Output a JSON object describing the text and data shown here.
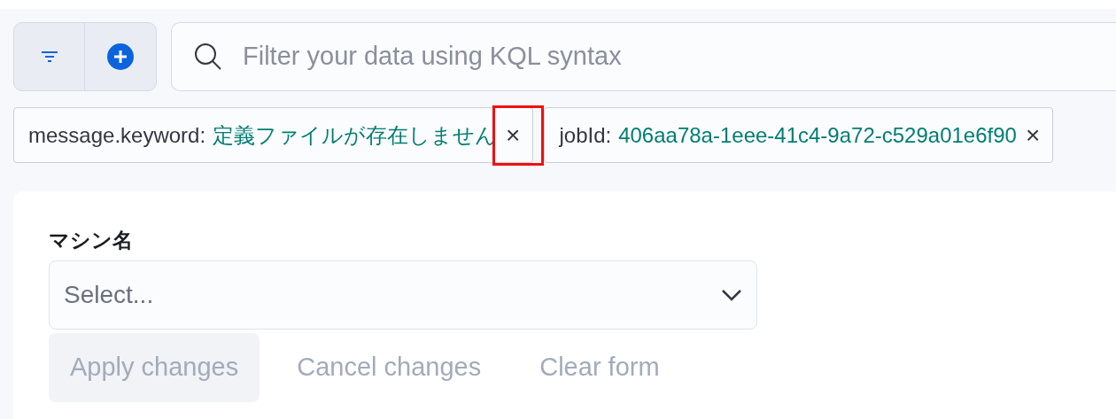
{
  "query_bar": {
    "placeholder": "Filter your data using KQL syntax"
  },
  "filters": [
    {
      "field": "message.keyword:",
      "value": "定義ファイルが存在しません",
      "remove": "×",
      "highlighted": true
    },
    {
      "field": "jobId:",
      "value": "406aa78a-1eee-41c4-9a72-c529a01e6f90",
      "remove": "×",
      "highlighted": false
    }
  ],
  "control": {
    "label": "マシン名",
    "placeholder": "Select..."
  },
  "buttons": [
    {
      "label": "Apply changes",
      "kind": "filled",
      "disabled": true
    },
    {
      "label": "Cancel changes",
      "kind": "empty",
      "disabled": true
    },
    {
      "label": "Clear form",
      "kind": "empty",
      "disabled": true
    }
  ]
}
